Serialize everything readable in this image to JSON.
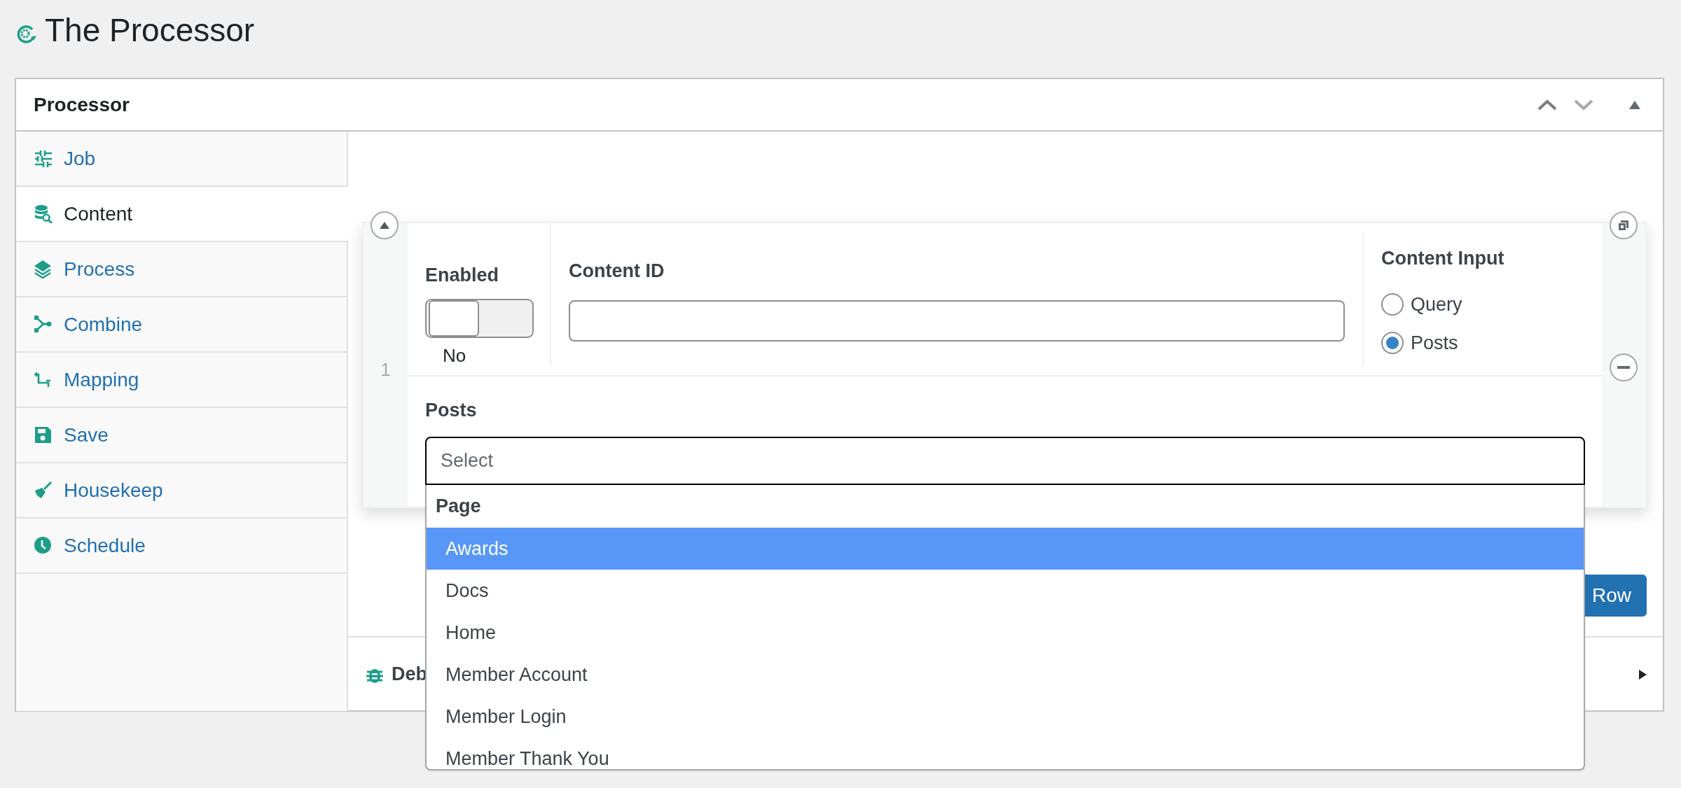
{
  "page_title": "The Processor",
  "panel": {
    "title": "Processor"
  },
  "tabs": [
    {
      "label": "Job",
      "selected": false
    },
    {
      "label": "Content",
      "selected": true
    },
    {
      "label": "Process",
      "selected": false
    },
    {
      "label": "Combine",
      "selected": false
    },
    {
      "label": "Mapping",
      "selected": false
    },
    {
      "label": "Save",
      "selected": false
    },
    {
      "label": "Housekeep",
      "selected": false
    },
    {
      "label": "Schedule",
      "selected": false
    }
  ],
  "row": {
    "number": "1",
    "enabled": {
      "label": "Enabled",
      "on": false,
      "state_text": "No"
    },
    "content_id": {
      "label": "Content ID"
    },
    "content_input": {
      "label": "Content Input",
      "options": [
        {
          "label": "Query",
          "selected": false
        },
        {
          "label": "Posts",
          "selected": true
        }
      ]
    },
    "posts": {
      "label": "Posts",
      "placeholder": "Select",
      "group": "Page",
      "items": [
        {
          "label": "Awards",
          "selected": true
        },
        {
          "label": "Docs",
          "selected": false
        },
        {
          "label": "Home",
          "selected": false
        },
        {
          "label": "Member Account",
          "selected": false
        },
        {
          "label": "Member Login",
          "selected": false
        },
        {
          "label": "Member Thank You",
          "selected": false
        }
      ]
    }
  },
  "add_row_button": "Row",
  "debug_section": {
    "title": "Deb",
    "expanded": false
  }
}
